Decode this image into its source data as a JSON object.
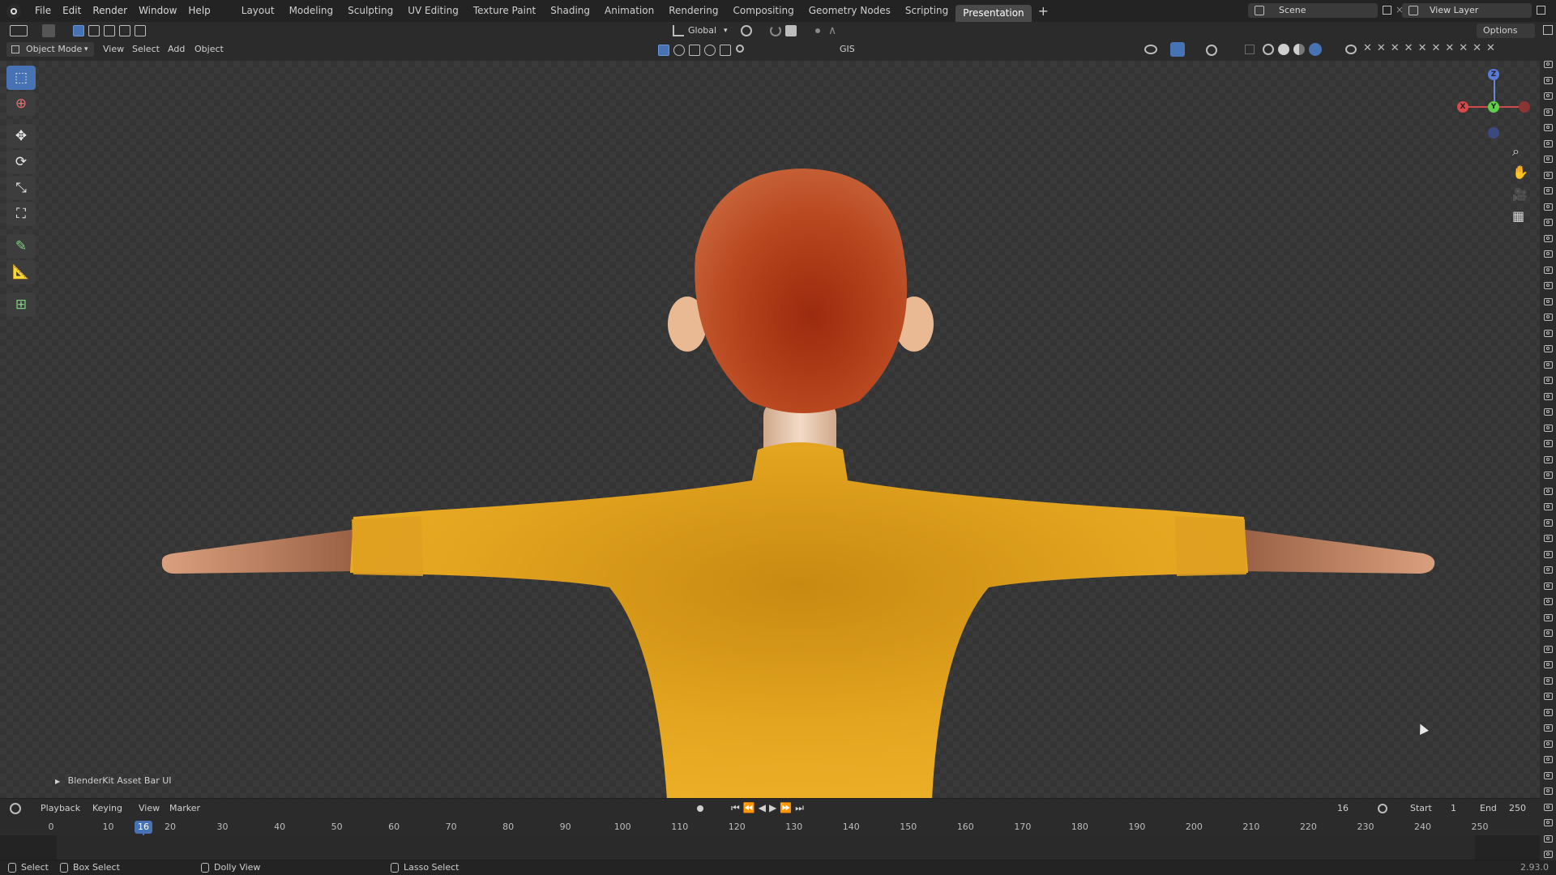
{
  "menu": [
    "File",
    "Edit",
    "Render",
    "Window",
    "Help"
  ],
  "workspaces": [
    "Layout",
    "Modeling",
    "Sculpting",
    "UV Editing",
    "Texture Paint",
    "Shading",
    "Animation",
    "Rendering",
    "Compositing",
    "Geometry Nodes",
    "Scripting",
    "Presentation"
  ],
  "active_workspace": "Presentation",
  "scene_name": "Scene",
  "view_layer": "View Layer",
  "header": {
    "mode": "Object Mode",
    "view": "View",
    "select": "Select",
    "add": "Add",
    "object": "Object",
    "transform_orientation": "Global",
    "gis": "GIS",
    "options": "Options"
  },
  "gizmo": {
    "x": "X",
    "y": "Y",
    "z": "Z"
  },
  "panel_label": "BlenderKit Asset Bar UI",
  "timeline": {
    "playback": "Playback",
    "keying": "Keying",
    "view": "View",
    "marker": "Marker",
    "current_frame": "16",
    "start_label": "Start",
    "start": "1",
    "end_label": "End",
    "end": "250",
    "ticks": [
      "0",
      "10",
      "20",
      "30",
      "40",
      "50",
      "60",
      "70",
      "80",
      "90",
      "100",
      "110",
      "120",
      "130",
      "140",
      "150",
      "160",
      "170",
      "180",
      "190",
      "200",
      "210",
      "220",
      "230",
      "240",
      "250"
    ],
    "playhead": "16"
  },
  "status": {
    "select": "Select",
    "box_select": "Box Select",
    "dolly_view": "Dolly View",
    "lasso_select": "Lasso Select",
    "version": "2.93.0"
  },
  "colors": {
    "accent": "#4772b3",
    "shirt": "#e8a820",
    "hair": "#b84a20",
    "skin": "#e0b08a"
  }
}
